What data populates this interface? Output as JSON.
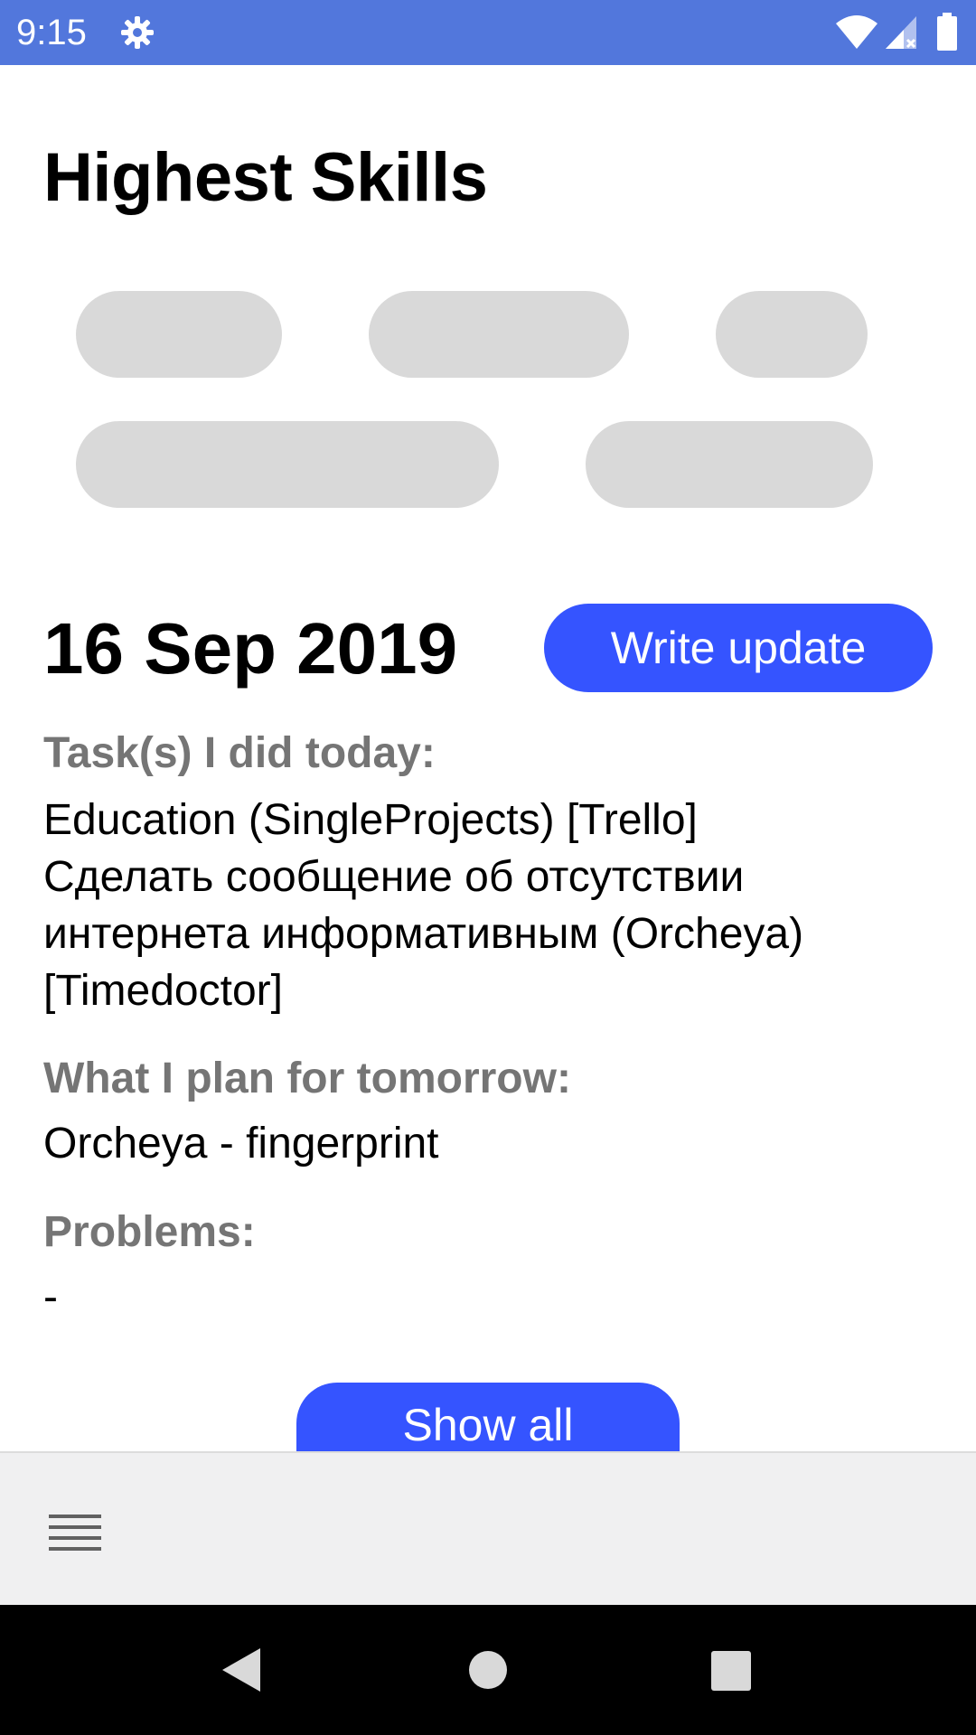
{
  "status_bar": {
    "time": "9:15",
    "icons": [
      "gear-icon",
      "wifi-icon",
      "signal-icon",
      "battery-icon"
    ],
    "background": "#5277dc"
  },
  "page": {
    "title": "Highest Skills"
  },
  "skills": {
    "chip_color": "#d9d9d9",
    "chip_count": 5
  },
  "report": {
    "date": "16 Sep 2019",
    "write_update_label": "Write update",
    "tasks_label": "Task(s) I did today:",
    "tasks_text": "Education (SingleProjects) [Trello]\nСделать сообщение об отсутствии интернета информативным (Orcheya) [Timedoctor]",
    "plan_label": "What I plan for tomorrow:",
    "plan_text": "Orcheya - fingerprint",
    "problems_label": "Problems:",
    "problems_text": "-",
    "show_all_label": "Show all",
    "accent_color": "#3554ff"
  },
  "bottom_bar": {
    "menu_icon": "menu-icon"
  },
  "nav_bar": {
    "icons": [
      "back-icon",
      "home-icon",
      "recents-icon"
    ]
  }
}
